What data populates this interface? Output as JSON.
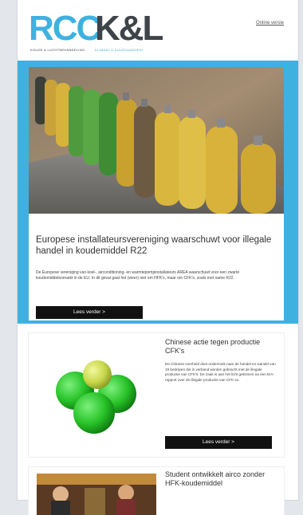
{
  "header": {
    "logo_part1": "RCC",
    "logo_part2": "K&L",
    "tagline_left": "KOUDE & LUCHTBEHANDELING",
    "tagline_right": "KLIMAAT & DUURZAAMHEID",
    "online_link": "Online versie"
  },
  "featured": {
    "title": "Europese installateursvereniging waarschuwt voor illegale handel in koudemiddel R22",
    "text": "De Europese vereniging van koel-, airconditioning- en warmtepompinstallateurs AREA waarschuwt voor een zwarte koudemiddelenmarkt in de EU. In dit geval gaat het (weer) niet om HFK's, maar om CFK's, zoals met name R22.",
    "button": "Lees verder >"
  },
  "articles": [
    {
      "title": "Chinese actie tegen productie CFK's",
      "text": "De Chinese overheid doet onderzoek naar de handel en wandel van 19 bedrijven die in verband worden gebracht met de illegale productie van CFK's. De zaak is aan het licht gekomen na een EIA-rapport over de illegale productie van CFK-11.",
      "button": "Lees verder >"
    },
    {
      "title": "Student ontwikkelt airco zonder HFK-koudemiddel"
    }
  ],
  "colors": {
    "brand_blue": "#3fb1e0",
    "brand_dark": "#3e444a",
    "button": "#111111"
  }
}
